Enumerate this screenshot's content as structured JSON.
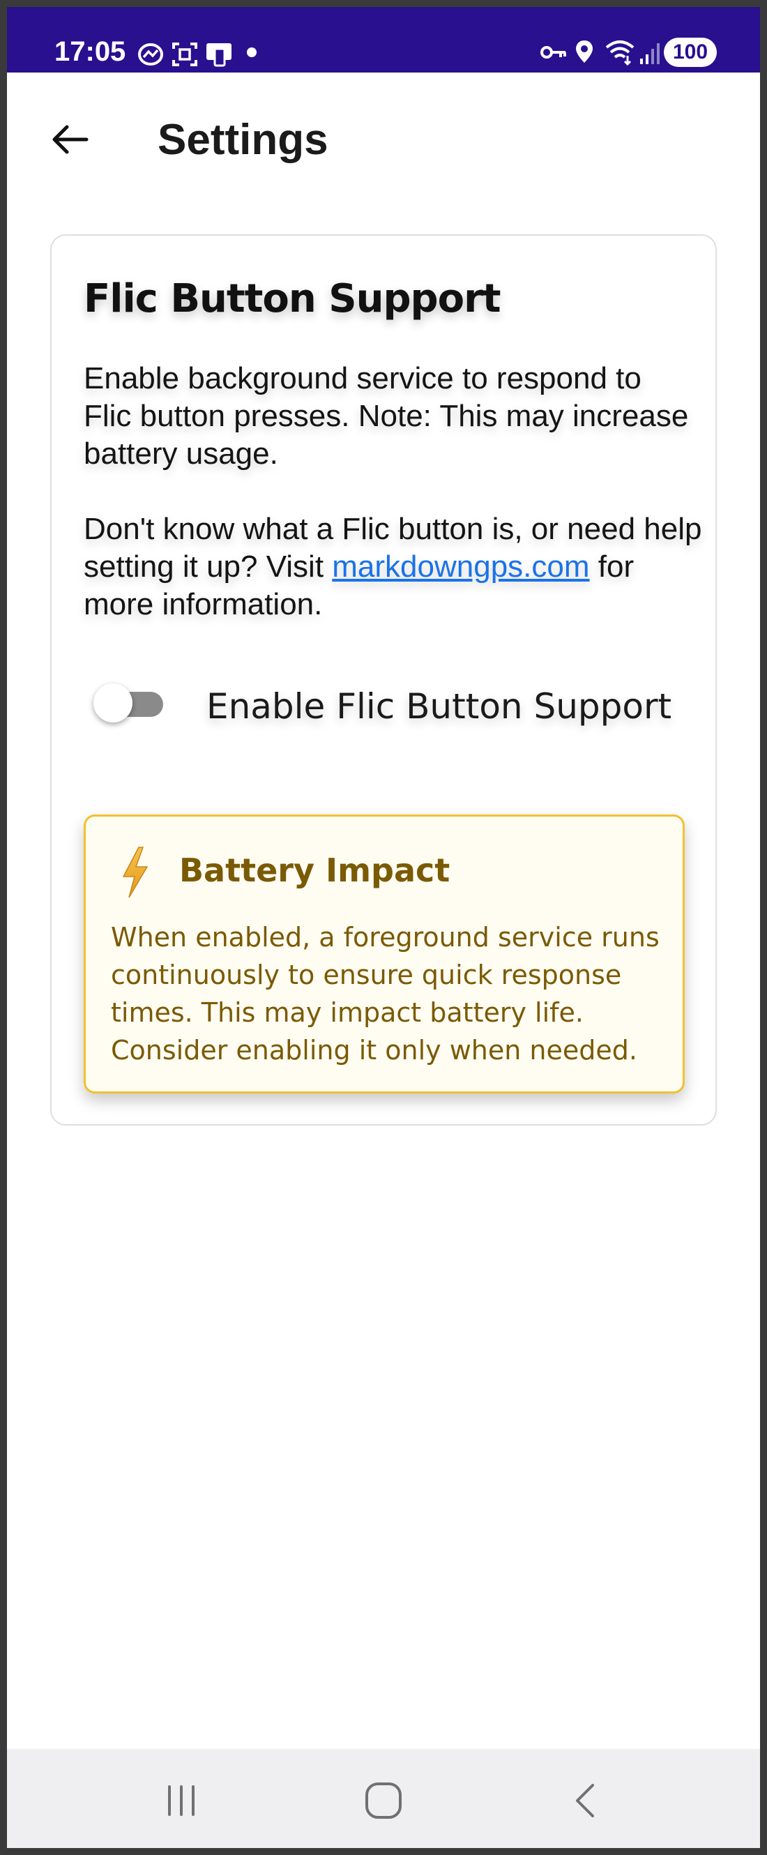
{
  "status_bar": {
    "time": "17:05",
    "battery": "100",
    "icons": [
      "messenger-icon",
      "screenshot-icon",
      "device-icon",
      "notification-dot",
      "vpn-key-icon",
      "location-icon",
      "wifi-icon",
      "signal-icon",
      "battery-icon"
    ]
  },
  "app_bar": {
    "back_icon": "arrow-left-icon",
    "title": "Settings"
  },
  "card": {
    "title": "Flic Button Support",
    "description": "Enable background service to respond to Flic button presses. Note: This may increase battery usage.",
    "help_prefix": "Don't know what a Flic button is, or need help setting it up? Visit ",
    "help_link": "markdowngps.com",
    "help_suffix": " for more information.",
    "toggle": {
      "label": "Enable Flic Button Support",
      "checked": false
    },
    "info_box": {
      "icon": "lightning-bolt-icon",
      "title": "Battery Impact",
      "text": "When enabled, a foreground service runs continuously to ensure quick response times. This may impact battery life. Consider enabling it only when needed."
    }
  },
  "nav_bar": {
    "buttons": [
      "recent-apps-icon",
      "home-icon",
      "back-icon"
    ]
  },
  "colors": {
    "status_bar": "#28108f",
    "link": "#1a73e8",
    "warning_border": "#f2c12e",
    "warning_bg": "#fffdf2",
    "warning_text": "#7a5a05"
  }
}
